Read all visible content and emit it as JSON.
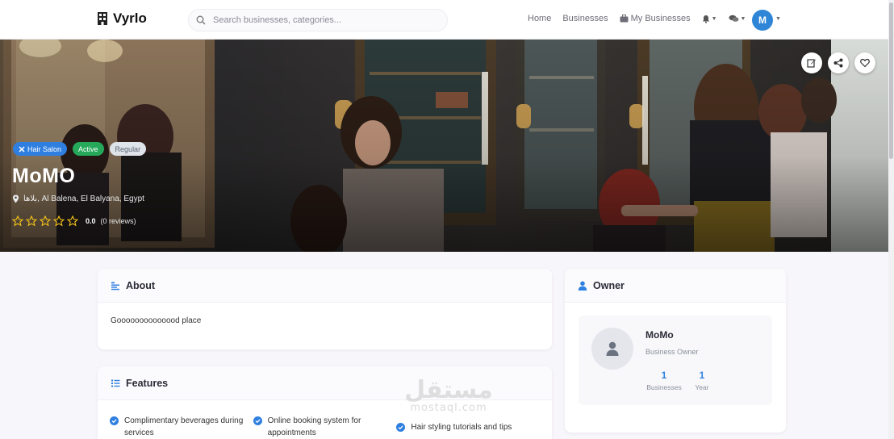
{
  "nav": {
    "brand": "Vyrlo",
    "search_placeholder": "Search businesses, categories...",
    "links": [
      "Home",
      "Businesses",
      "My Businesses"
    ],
    "avatar_initial": "M"
  },
  "hero": {
    "badges": [
      "Hair Salon",
      "Active",
      "Regular"
    ],
    "name": "MoMO",
    "location": "بلاها, Al Balena, El Balyana, Egypt",
    "rating_value": "0.0",
    "reviews": "(0 reviews)",
    "stars_filled": 0,
    "stars_total": 5
  },
  "about": {
    "title": "About",
    "text": "Goooooooooooood place"
  },
  "features": {
    "title": "Features",
    "items": [
      "Complimentary beverages during services",
      "Online booking system for appointments",
      "Hair styling tutorials and tips"
    ]
  },
  "owner": {
    "title": "Owner",
    "name": "MoMo",
    "role": "Business Owner",
    "stats": [
      {
        "value": "1",
        "label": "Businesses"
      },
      {
        "value": "1",
        "label": "Year"
      }
    ]
  },
  "watermark": {
    "arabic": "مستقل",
    "latin": "mostaql.com"
  },
  "colors": {
    "primary": "#2f7fe0",
    "success": "#25a85a",
    "page_bg": "#f7f6fa"
  }
}
